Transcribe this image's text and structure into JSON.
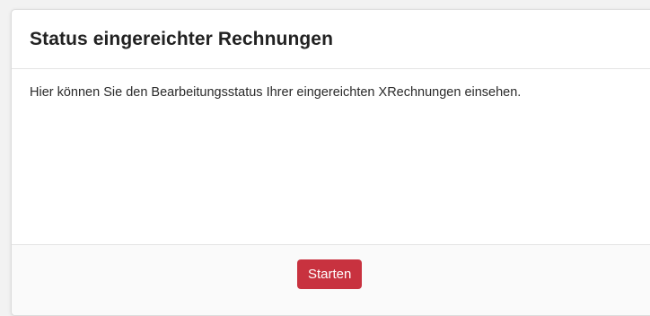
{
  "card": {
    "title": "Status eingereichter Rechnungen",
    "description": "Hier können Sie den Bearbeitungsstatus Ihrer eingereichten XRechnungen einsehen.",
    "start_label": "Starten"
  },
  "colors": {
    "button": "#c8323f",
    "title": "#222222",
    "background": "#f2f2f2"
  }
}
